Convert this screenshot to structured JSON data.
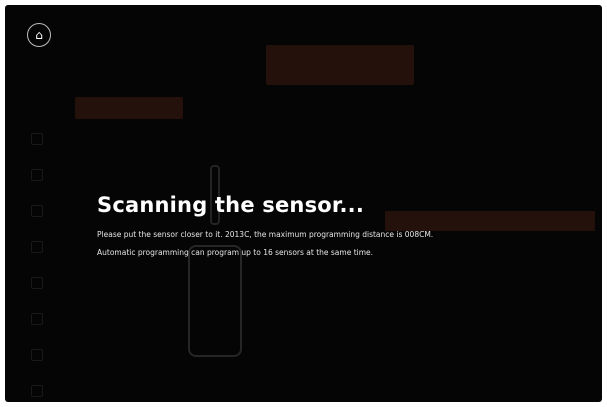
{
  "scan": {
    "title": "Scanning the sensor...",
    "line1": "Please put the sensor closer to it. 2013C, the maximum programming distance is 008CM.",
    "line2": "Automatic programming can program up to 16 sensors at the same time."
  },
  "icons": {
    "home": "home-icon"
  },
  "colors": {
    "accent": "#6b2c1b",
    "background": "#050505",
    "text": "#ffffff"
  }
}
